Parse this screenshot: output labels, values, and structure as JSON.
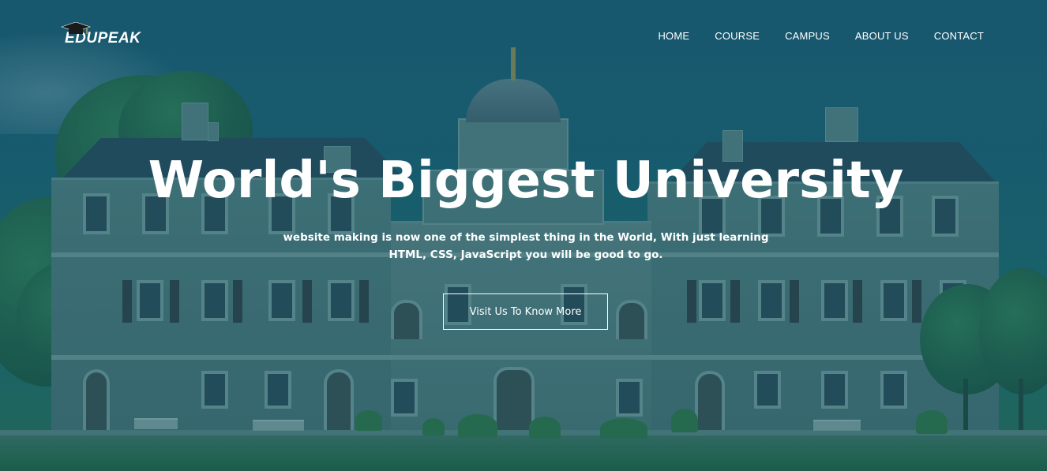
{
  "brand": {
    "logo_text": "EDUPEAK",
    "logo_icon": "graduation-cap-icon"
  },
  "nav": {
    "items": [
      {
        "label": "HOME"
      },
      {
        "label": "COURSE"
      },
      {
        "label": "CAMPUS"
      },
      {
        "label": "ABOUT US"
      },
      {
        "label": "CONTACT"
      }
    ]
  },
  "hero": {
    "title": "World's Biggest University",
    "subtitle": "website making is now one of the simplest thing in the World, With just learning HTML, CSS, JavaScript you will be good to go.",
    "cta_label": "Visit Us To Know More",
    "background": "university-building-photo"
  },
  "colors": {
    "overlay": "#0e5264",
    "text": "#ffffff"
  }
}
